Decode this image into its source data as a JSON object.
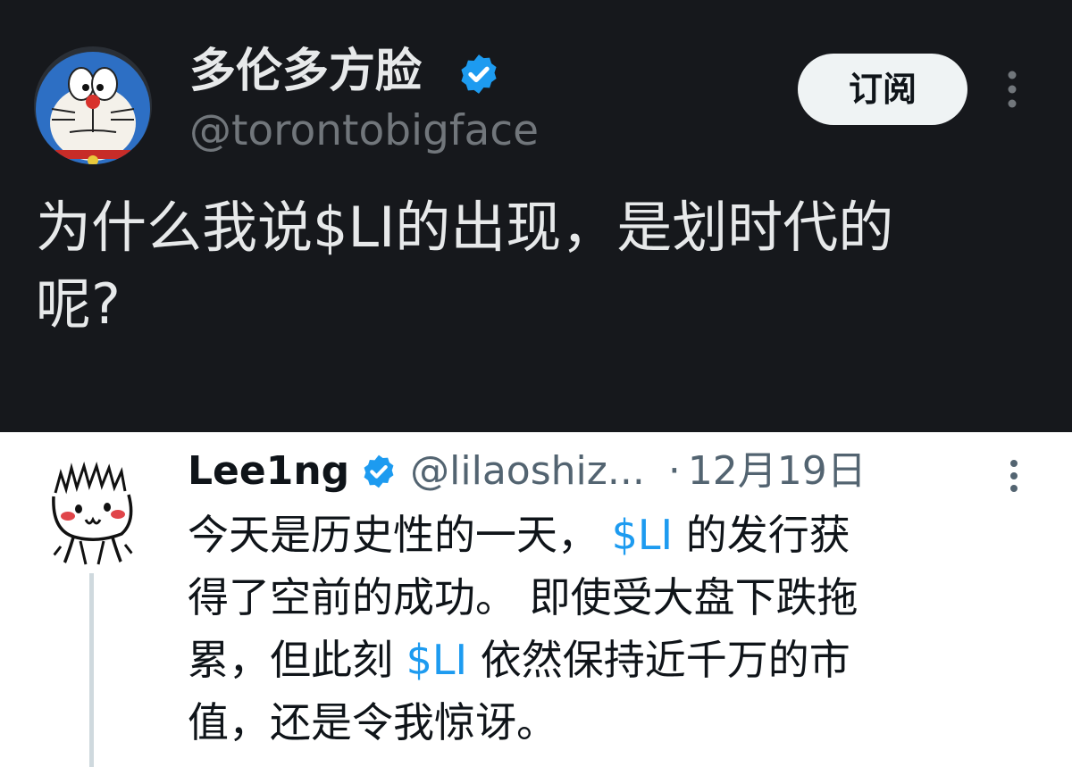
{
  "main_tweet": {
    "display_name": "多伦多方脸",
    "handle": "@torontobigface",
    "subscribe_label": "订阅",
    "text_line_1": "为什么我说$LI的出现，是划时代的",
    "text_line_2": "呢?"
  },
  "reply_tweet": {
    "display_name": "Lee1ng",
    "handle": "@lilaoshiz...",
    "separator": "·",
    "date": "12月19日",
    "lines": [
      {
        "pre": "今天是历史性的一天， ",
        "cashtag": "$LI",
        "post": " 的发行获"
      },
      {
        "text": "得了空前的成功。 即使受大盘下跌拖"
      },
      {
        "pre": "累，但此刻 ",
        "cashtag": "$LI",
        "post": " 依然保持近千万的市"
      },
      {
        "text": "值，还是令我惊讶。"
      }
    ]
  },
  "colors": {
    "dark_bg": "#16181c",
    "verified_blue": "#1d9bf0",
    "cashtag": "#1d9bf0",
    "handle_gray_dark": "#71767b",
    "handle_gray_light": "#536471"
  },
  "icons": {
    "verified": "verified-badge-icon",
    "more": "more-vertical-icon"
  }
}
